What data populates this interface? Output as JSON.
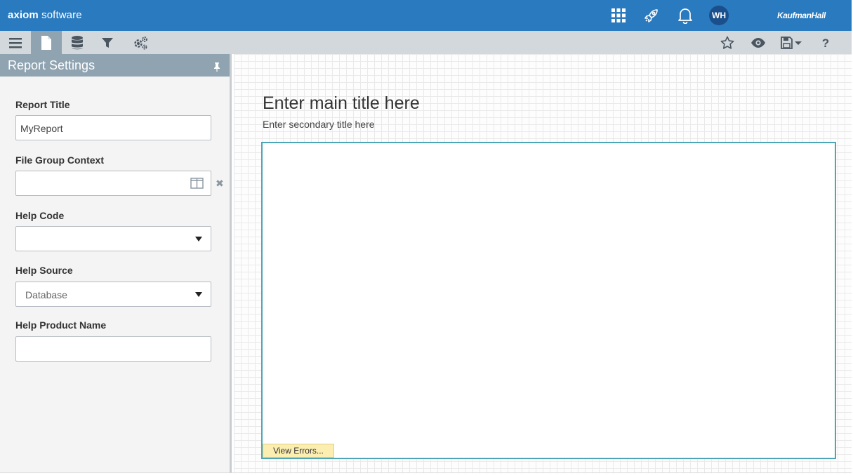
{
  "header": {
    "brand_bold": "axiom",
    "brand_light": "software",
    "avatar_initials": "WH",
    "partner_logo": "KaufmanHall",
    "icons": [
      "apps-grid-icon",
      "rocket-icon",
      "bell-icon"
    ]
  },
  "toolbar": {
    "left_icons": [
      "menu-icon",
      "document-icon",
      "database-icon",
      "filter-icon",
      "gears-icon"
    ],
    "right_icons": [
      "star-icon",
      "eye-icon",
      "save-icon",
      "help-icon"
    ]
  },
  "sidebar": {
    "title": "Report Settings",
    "fields": {
      "report_title": {
        "label": "Report Title",
        "value": "MyReport"
      },
      "file_group": {
        "label": "File Group Context",
        "value": ""
      },
      "help_code": {
        "label": "Help Code",
        "value": ""
      },
      "help_source": {
        "label": "Help Source",
        "value": "Database"
      },
      "help_product": {
        "label": "Help Product Name",
        "value": ""
      }
    }
  },
  "canvas": {
    "main_title": "Enter main title here",
    "secondary_title": "Enter secondary title here",
    "view_errors_label": "View Errors..."
  },
  "colors": {
    "header_blue": "#2a7abf",
    "toolbar_gray": "#d3d8dc",
    "panel_head": "#8fa3b1",
    "report_border": "#4da6b7",
    "error_button": "#fbeeb0"
  }
}
